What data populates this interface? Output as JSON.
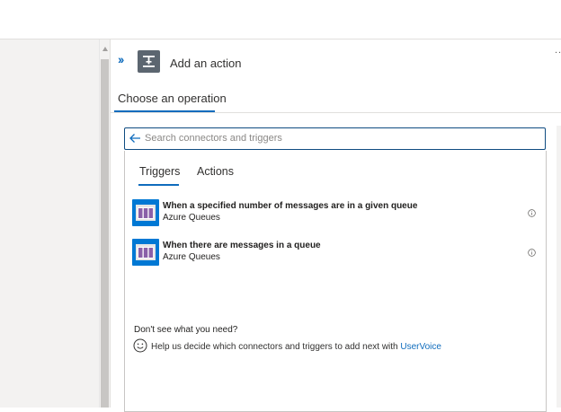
{
  "panel": {
    "title": "Add an action",
    "tab": "Choose an operation",
    "more_dots": ".."
  },
  "search": {
    "placeholder": "Search connectors and triggers"
  },
  "tabs": [
    {
      "label": "Triggers",
      "active": true
    },
    {
      "label": "Actions",
      "active": false
    }
  ],
  "triggers": [
    {
      "title": "When a specified number of messages are in a given queue",
      "connector": "Azure Queues",
      "icon": "azure-queues-icon"
    },
    {
      "title": "When there are messages in a queue",
      "connector": "Azure Queues",
      "icon": "azure-queues-icon"
    }
  ],
  "help": {
    "heading": "Don't see what you need?",
    "text": "Help us decide which connectors and triggers to add next with ",
    "link": "UserVoice"
  },
  "colors": {
    "accent": "#0f6cbd",
    "connector_blue": "#0078d4",
    "queue_purple": "#8a5fa8"
  }
}
